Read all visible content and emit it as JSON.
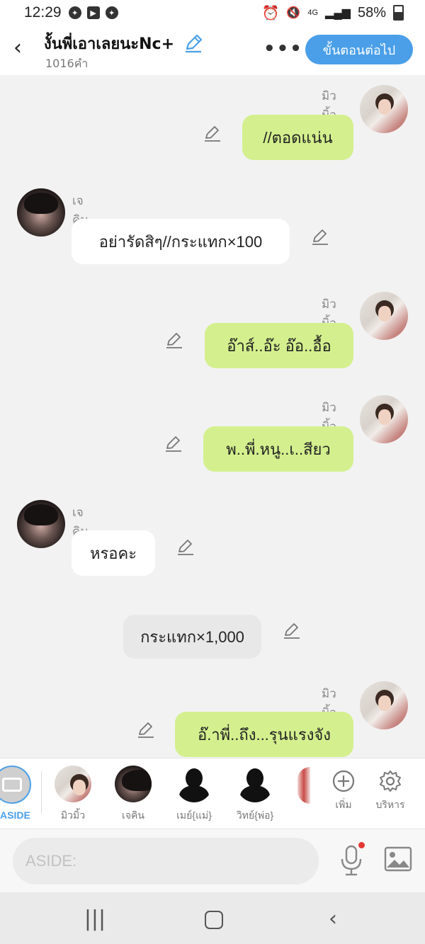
{
  "status": {
    "time": "12:29",
    "battery_text": "58%",
    "network": "4G"
  },
  "header": {
    "title": "งั้นพี่เอาเลยนะNc+",
    "word_count": "1016คำ",
    "next_label": "ขั้นตอนต่อไป"
  },
  "messages": [
    {
      "speaker": "มิวมิ้ว",
      "text": "//ตอดแน่น",
      "side": "right"
    },
    {
      "speaker": "เจคิน",
      "text": "อย่ารัดสิๆ//กระแทก×100",
      "side": "left"
    },
    {
      "speaker": "มิวมิ้ว",
      "text": "อ๊าส์..อ๊ะ อ๊อ..อื้อ",
      "side": "right"
    },
    {
      "speaker": "มิวมิ้ว",
      "text": "พ..พี่.หนู..เ..สียว",
      "side": "right"
    },
    {
      "speaker": "เจคิน",
      "text": "หรอคะ",
      "side": "left"
    },
    {
      "speaker": "",
      "text": "กระแทก×1,000",
      "side": "center"
    },
    {
      "speaker": "มิวมิ้ว",
      "text": "อ๊.าพี่..ถึง...รุนแรงจัง",
      "side": "right"
    }
  ],
  "characters": {
    "aside_label": "ASIDE",
    "items": [
      {
        "name": "มิวมิ้ว"
      },
      {
        "name": "เจคิน"
      },
      {
        "name": "เมย์{แม่}"
      },
      {
        "name": "วิทย์{พ่อ}"
      }
    ],
    "add_label": "เพิ่ม",
    "manage_label": "บริหาร"
  },
  "input": {
    "placeholder": "ASIDE:"
  },
  "colors": {
    "accent": "#4a9fe8",
    "bubble_right": "#d4f08e",
    "bubble_left": "#ffffff",
    "bubble_center": "#e8e8e8"
  }
}
